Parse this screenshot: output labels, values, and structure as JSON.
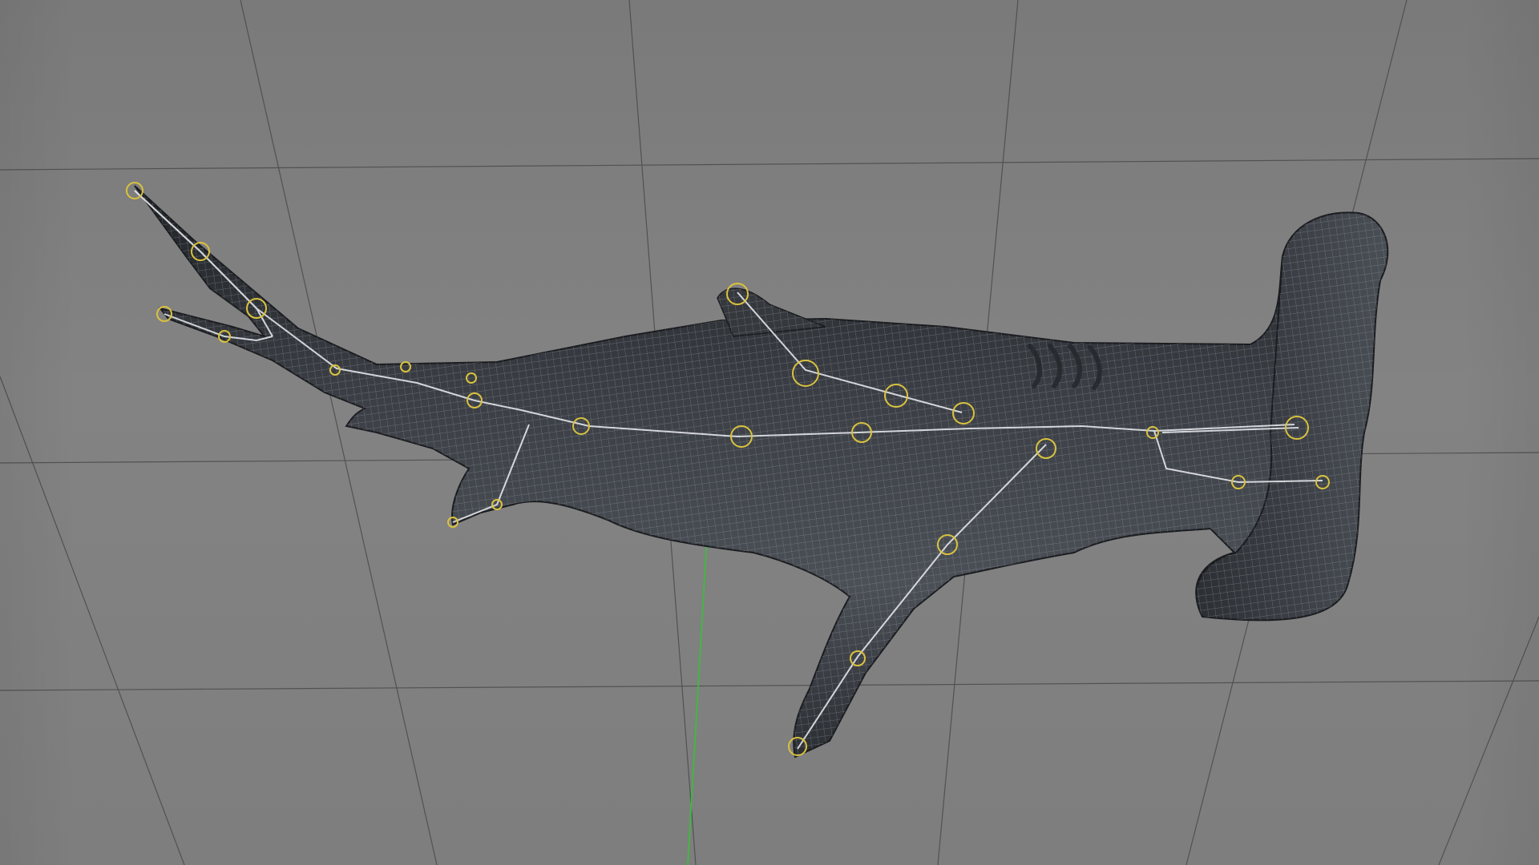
{
  "viewport": {
    "background_color": "#7d7d7d",
    "grid_line_color": "#4a4a4a",
    "y_axis_color": "#3dbb3d",
    "mesh_fill_color": "#3c3f44",
    "mesh_wire_color": "#8d9197",
    "rig_bone_color": "#e4e6ea",
    "rig_joint_color": "#d9c23e"
  },
  "model": {
    "subject": "hammerhead-shark",
    "display": "wireframe-on-shaded",
    "rig": "joint-skeleton"
  }
}
